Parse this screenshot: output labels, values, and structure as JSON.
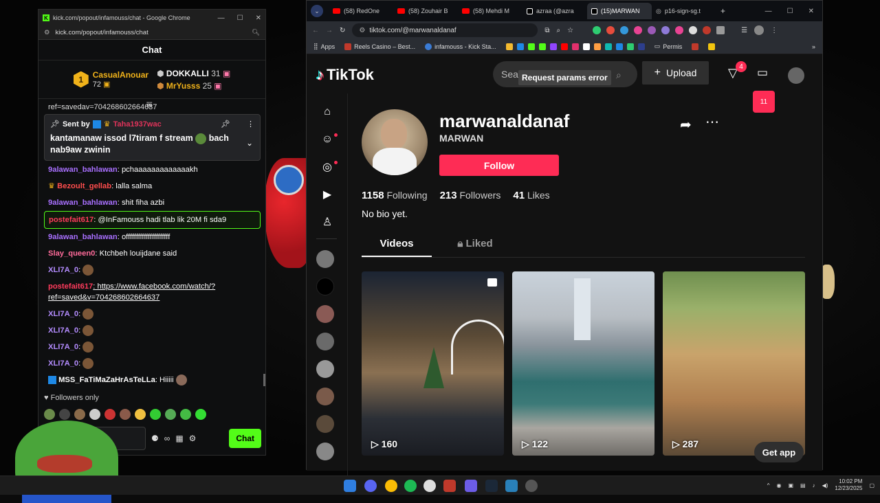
{
  "chat_window": {
    "title": "kick.com/popout/infamouss/chat - Google Chrome",
    "url": "kick.com/popout/infamouss/chat",
    "header": "Chat",
    "leaderboard": [
      {
        "rank": "1",
        "name": "CasualAnouar",
        "count": "72"
      },
      {
        "name": "DOKKALLI",
        "count": "31"
      },
      {
        "name": "MrYusss",
        "count": "25"
      }
    ],
    "scrolled_text": "ref=savedav=704268602664637",
    "pinned": {
      "sent_by_label": "Sent by",
      "user": "Taha1937wac",
      "message": "kantamanaw issod l7tiram f stream",
      "message_tail": "bach nab9aw zwinin"
    },
    "messages": [
      {
        "user": "9alawan_bahlawan",
        "color": "#a970ff",
        "text": ": pchaaaaaaaaaaaaakh"
      },
      {
        "user": "Bezoult_gellab",
        "color": "#ff4d4d",
        "text": ": lalla salma"
      },
      {
        "user": "9alawan_bahlawan",
        "color": "#a970ff",
        "text": ": shit fiha azbi"
      },
      {
        "user": "postefait617",
        "color": "#ff3b5c",
        "text": ": @InFamouss hadi tlab lik 20M fi sda9"
      },
      {
        "user": "9alawan_bahlawan",
        "color": "#a970ff",
        "text": ": offffffffffffffffffffff"
      },
      {
        "user": "Slay_queen0",
        "color": "#ff6b9a",
        "text": ": Ktchbeh louijdane said"
      },
      {
        "user": "XLI7A_0",
        "color": "#b48cff",
        "text": ":"
      },
      {
        "user": "postefait617",
        "color": "#ff3b5c",
        "text": ": https://www.facebook.com/watch/?",
        "text2": "ref=saved&v=704268602664637"
      },
      {
        "user": "XLI7A_0",
        "color": "#b48cff",
        "text": ":"
      },
      {
        "user": "XLI7A_0",
        "color": "#b48cff",
        "text": ":"
      },
      {
        "user": "XLI7A_0",
        "color": "#b48cff",
        "text": ":"
      },
      {
        "user": "XLI7A_0",
        "color": "#b48cff",
        "text": ":"
      },
      {
        "user": "MSS_FaTiMaZaHrAsTeLLa",
        "color": "#ffffff",
        "text": ": Hiiiii"
      }
    ],
    "followers_only": "Followers only",
    "input_placeholder": "Send a",
    "chat_button": "Chat"
  },
  "browser": {
    "tabs": [
      {
        "label": "(58) RedOne",
        "icon": "youtube-icon"
      },
      {
        "label": "(58) Zouhair B",
        "icon": "youtube-icon"
      },
      {
        "label": "(58) Mehdi M",
        "icon": "youtube-icon"
      },
      {
        "label": "azraa (@azra",
        "icon": "tiktok-icon"
      },
      {
        "label": "(15)MARWAN",
        "icon": "tiktok-icon"
      },
      {
        "label": "p16-sign-sg.t",
        "icon": "globe-icon"
      }
    ],
    "url": "tiktok.com/@marwanaldanaf",
    "bookmarks": [
      "Apps",
      "Reels Casino – Best...",
      "infamouss - Kick Sta...",
      "Permis"
    ]
  },
  "tiktok": {
    "logo": "TikTok",
    "search_placeholder": "Sea",
    "tooltip": "Request params error",
    "upload": "Upload",
    "inbox_count": "4",
    "messages_count": "11",
    "username": "marwanaldanaf",
    "nickname": "MARWAN",
    "follow": "Follow",
    "stats": {
      "following": "1158",
      "following_label": "Following",
      "followers": "213",
      "followers_label": "Followers",
      "likes": "41",
      "likes_label": "Likes"
    },
    "bio": "No bio yet.",
    "tab_videos": "Videos",
    "tab_liked": "Liked",
    "videos": [
      {
        "views": "160"
      },
      {
        "views": "122"
      },
      {
        "views": "287"
      }
    ],
    "get_app": "Get app"
  },
  "taskbar": {
    "time": "10:02 PM",
    "date": "12/23/2025"
  }
}
